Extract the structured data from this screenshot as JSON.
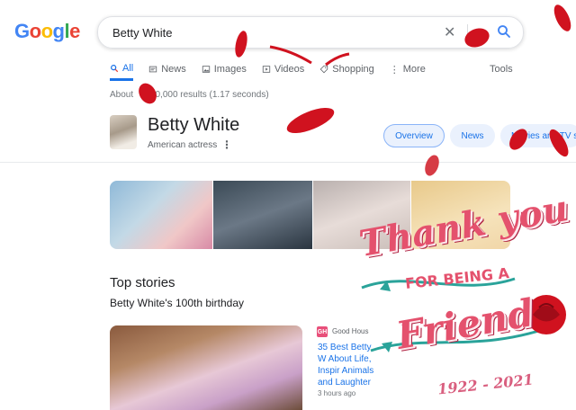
{
  "logo": {
    "text_parts": [
      "G",
      "o",
      "o",
      "g",
      "l",
      "e"
    ]
  },
  "search": {
    "value": "Betty White",
    "clear_icon": "close-icon",
    "submit_icon": "search-icon"
  },
  "tabs": [
    {
      "label": "All",
      "icon": "search-icon",
      "active": true
    },
    {
      "label": "News",
      "icon": "news-icon"
    },
    {
      "label": "Images",
      "icon": "image-icon"
    },
    {
      "label": "Videos",
      "icon": "video-icon"
    },
    {
      "label": "Shopping",
      "icon": "tag-icon"
    },
    {
      "label": "More",
      "icon": "more-vert-icon"
    }
  ],
  "tools_label": "Tools",
  "results_prefix": "About",
  "results_suffix": "00,000 results (1.17 seconds)",
  "entity": {
    "name": "Betty White",
    "description": "American actress",
    "more": "⋮"
  },
  "chips": [
    "Overview",
    "News",
    "Movies and TV sh"
  ],
  "top_stories": {
    "title": "Top stories",
    "subtitle": "Betty White's 100th birthday",
    "story": {
      "source_badge": "GH",
      "source": "Good Hous",
      "headline": "35 Best Betty W About Life, Inspir Animals and Laughter",
      "time": "3 hours ago"
    }
  },
  "overlay": {
    "line1": "Thank you",
    "line2": "FOR BEING A",
    "line3": "Friend",
    "years": "1922 - 2021"
  },
  "colors": {
    "accent": "#1a73e8",
    "overlay_pink": "#e4516d",
    "petal_red": "#d0121f"
  }
}
